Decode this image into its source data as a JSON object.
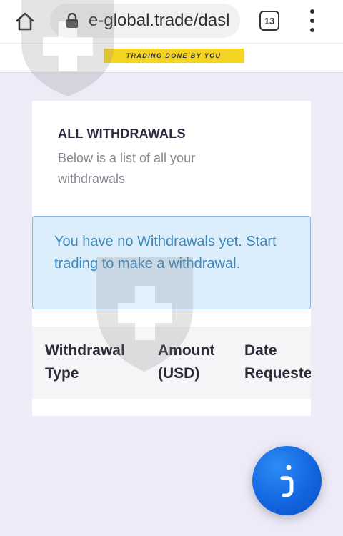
{
  "browser": {
    "url": "e-global.trade/dasl",
    "tab_count": "13",
    "icons": [
      "home-icon",
      "lock-icon",
      "tabs-icon",
      "overflow-menu-icon"
    ]
  },
  "site": {
    "tagline": "TRADING DONE BY YOU",
    "tagline_color": "#f5d321"
  },
  "withdrawals": {
    "title": "ALL WITHDRAWALS",
    "subtitle": "Below is a list of all your withdrawals",
    "empty_message": "You have no Withdrawals yet. Start trading to make a withdrawal.",
    "columns": [
      "Withdrawal Type",
      "Amount (USD)",
      "Date Requeste"
    ]
  },
  "chat": {
    "icon": "chat-widget-icon",
    "color": "#1366e0"
  }
}
